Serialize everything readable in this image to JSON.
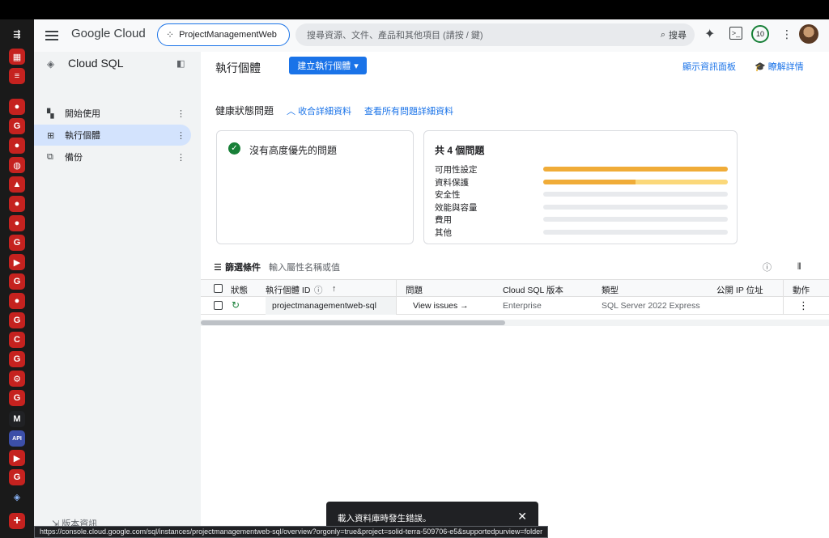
{
  "header": {
    "brand": "Google Cloud",
    "project": "ProjectManagementWeb",
    "search_placeholder": "搜尋資源、文件、產品和其他項目 (請按 / 鍵)",
    "search_button": "搜尋",
    "notification_count": "10"
  },
  "sidebar": {
    "title": "Cloud SQL",
    "items": [
      {
        "label": "開始使用"
      },
      {
        "label": "執行個體"
      },
      {
        "label": "備份"
      }
    ],
    "footer": "版本資訊"
  },
  "main": {
    "page_title": "執行個體",
    "create_button": "建立執行個體",
    "show_dashboard": "顯示資訊面板",
    "learn_more": "瞭解詳情",
    "health_title": "健康狀態問題",
    "collapse_details": "收合詳細資料",
    "view_all_details": "查看所有問題詳細資料",
    "no_priority_issue": "沒有高度優先的問題",
    "issues_total": "共 4 個問題",
    "issue_rows": [
      {
        "label": "可用性設定",
        "fill": 1.0,
        "fill2": 0.0
      },
      {
        "label": "資料保護",
        "fill": 0.5,
        "fill2": 0.5
      },
      {
        "label": "安全性",
        "fill": 0.0,
        "fill2": 0.0
      },
      {
        "label": "效能與容量",
        "fill": 0.0,
        "fill2": 0.0
      },
      {
        "label": "費用",
        "fill": 0.0,
        "fill2": 0.0
      },
      {
        "label": "其他",
        "fill": 0.0,
        "fill2": 0.0
      }
    ],
    "filter_label": "篩選條件",
    "filter_placeholder": "輸入屬性名稱或值",
    "columns": {
      "status": "狀態",
      "instance_id": "執行個體 ID",
      "issues": "問題",
      "version": "Cloud SQL 版本",
      "type": "類型",
      "public_ip": "公開 IP 位址",
      "actions": "動作"
    },
    "rows": [
      {
        "instance_id": "projectmanagementweb-sql",
        "issues": "View issues",
        "version": "Enterprise",
        "type": "SQL Server 2022 Express"
      }
    ]
  },
  "snackbar": {
    "message": "載入資料庫時發生錯誤。"
  },
  "status_url": "https://console.cloud.google.com/sql/instances/projectmanagementweb-sql/overview?orgonly=true&project=solid-terra-509706-e5&supportedpurview=folder",
  "colors": {
    "accent": "#1a73e8",
    "warning": "#f0ac38",
    "warning_light": "#fbd87a",
    "success": "#188038"
  }
}
